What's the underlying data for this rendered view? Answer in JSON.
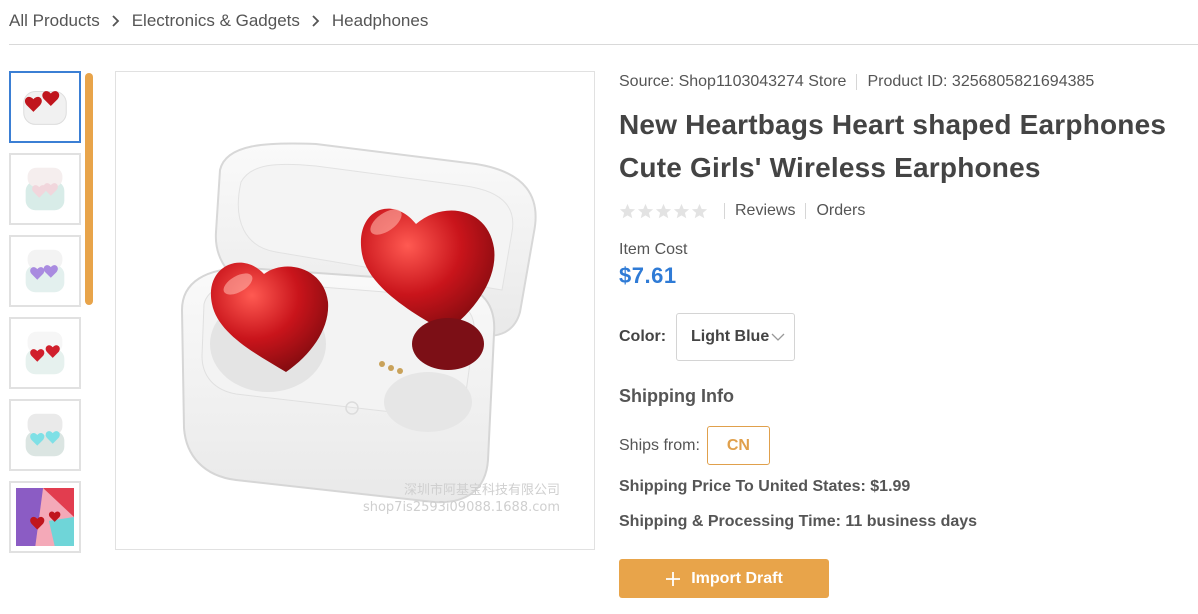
{
  "breadcrumb": [
    "All Products",
    "Electronics & Gadgets",
    "Headphones"
  ],
  "product": {
    "source": "Source: Shop1103043274 Store",
    "product_id": "Product ID: 3256805821694385",
    "title_line1": "New Heartbags Heart shaped Earphones",
    "title_line2": "Cute Girls' Wireless Earphones",
    "rating": 0,
    "reviews_label": "Reviews",
    "orders_label": "Orders",
    "cost_label": "Item Cost",
    "price": "$7.61"
  },
  "color": {
    "label": "Color:",
    "selected": "Light Blue"
  },
  "shipping": {
    "heading": "Shipping Info",
    "ships_from_label": "Ships from:",
    "ships_from_value": "CN",
    "price_line": "Shipping Price To United States:  $1.99",
    "time_line": "Shipping & Processing Time:  11 business days"
  },
  "watermark": {
    "line1": "深圳市阿基宝科技有限公司",
    "line2": "shop7is2593i09088.1688.com"
  },
  "import_label": "Import Draft",
  "colors": {
    "accent": "#e8a44a",
    "price": "#2f7bd6",
    "active_thumb": "#3b7fd4",
    "heart_red": "#c0151d"
  }
}
